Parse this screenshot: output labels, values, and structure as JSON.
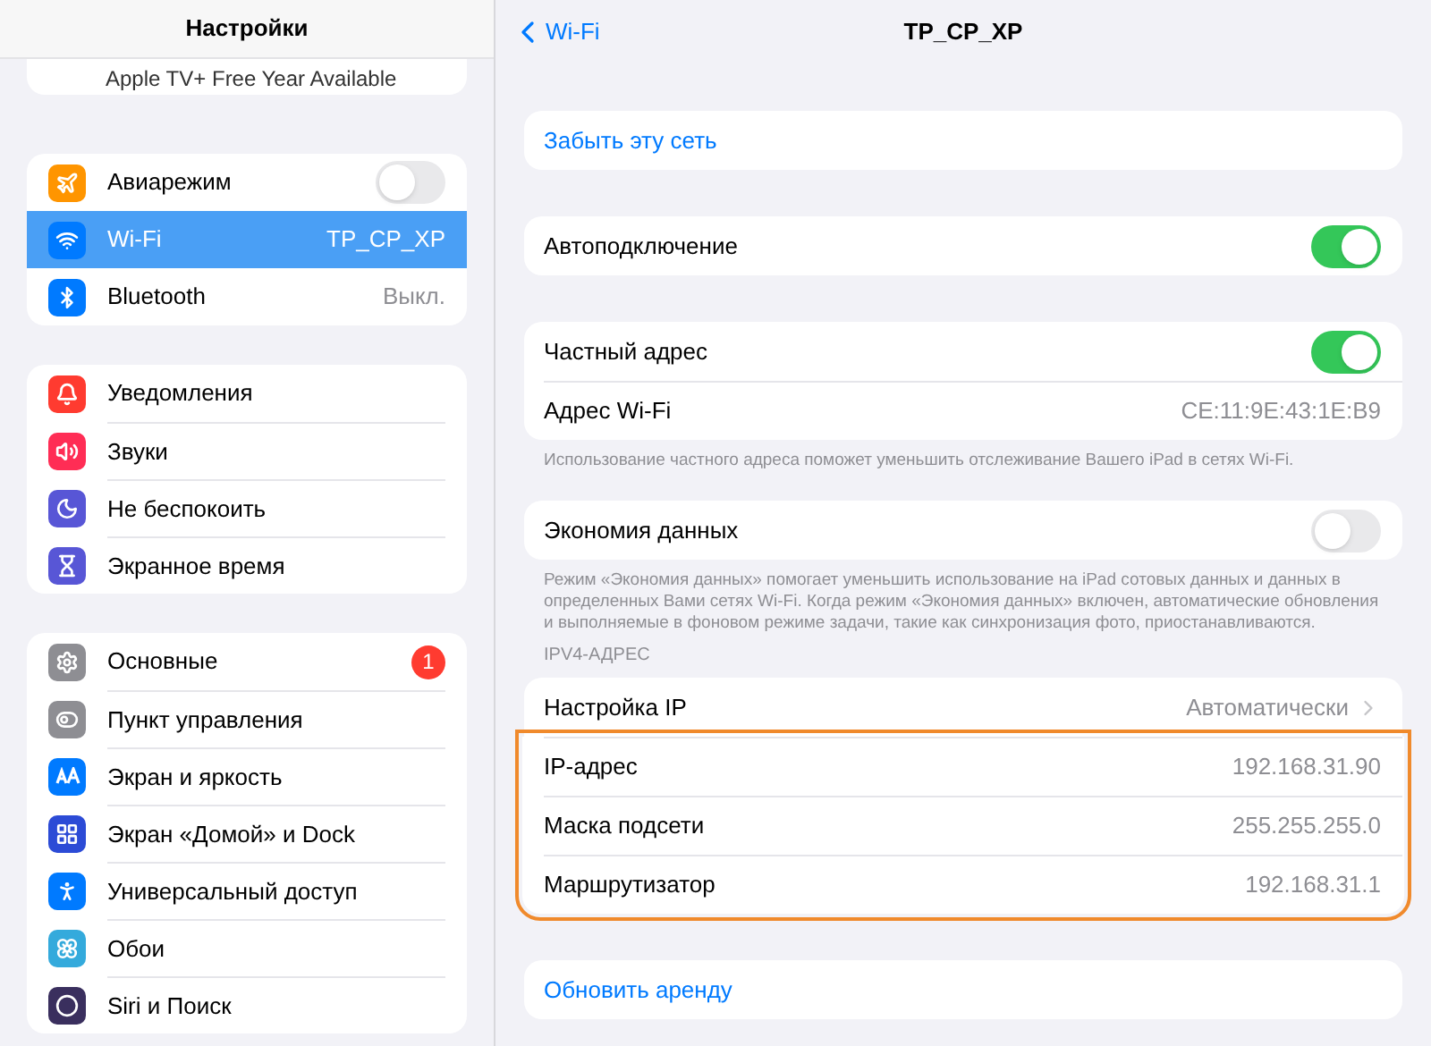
{
  "sidebar": {
    "title": "Настройки",
    "partial_item": "Apple TV+ Free Year Available",
    "groups": [
      [
        {
          "label": "Авиарежим",
          "kind": "toggle",
          "on": false,
          "selected": false
        },
        {
          "label": "Wi-Fi",
          "kind": "value",
          "value": "TP_CP_XP",
          "selected": true
        },
        {
          "label": "Bluetooth",
          "kind": "value",
          "value": "Выкл.",
          "selected": false
        }
      ],
      [
        {
          "label": "Уведомления",
          "kind": "plain",
          "selected": false
        },
        {
          "label": "Звуки",
          "kind": "plain",
          "selected": false
        },
        {
          "label": "Не беспокоить",
          "kind": "plain",
          "selected": false
        },
        {
          "label": "Экранное время",
          "kind": "plain",
          "selected": false
        }
      ],
      [
        {
          "label": "Основные",
          "kind": "badge",
          "value": "1",
          "selected": false
        },
        {
          "label": "Пункт управления",
          "kind": "plain",
          "selected": false
        },
        {
          "label": "Экран и яркость",
          "kind": "plain",
          "selected": false
        },
        {
          "label": "Экран «Домой» и Dock",
          "kind": "plain",
          "selected": false
        },
        {
          "label": "Универсальный доступ",
          "kind": "plain",
          "selected": false
        },
        {
          "label": "Обои",
          "kind": "plain",
          "selected": false
        },
        {
          "label": "Siri и Поиск",
          "kind": "plain",
          "selected": false
        }
      ]
    ]
  },
  "detail": {
    "back": "Wi-Fi",
    "title": "TP_CP_XP",
    "sections": [
      {
        "rows": [
          {
            "kind": "link",
            "label": "Забыть эту сеть"
          }
        ]
      },
      {
        "rows": [
          {
            "kind": "toggle",
            "label": "Автоподключение",
            "on": true
          }
        ]
      },
      {
        "rows": [
          {
            "kind": "toggle",
            "label": "Частный адрес",
            "on": true
          },
          {
            "kind": "value",
            "label": "Адрес Wi-Fi",
            "value": "CE:11:9E:43:1E:B9"
          }
        ],
        "footer": "Использование частного адреса поможет уменьшить отслеживание Вашего iPad в сетях Wi-Fi."
      },
      {
        "rows": [
          {
            "kind": "toggle",
            "label": "Экономия данных",
            "on": false
          }
        ],
        "footer": "Режим «Экономия данных» помогает уменьшить использование на iPad сотовых данных и данных в определенных Вами сетях Wi-Fi. Когда режим «Экономия данных» включен, автоматические обновления и выполняемые в фоновом режиме задачи, такие как синхронизация фото, приостанавливаются."
      },
      {
        "header": "IPV4-АДРЕС",
        "rows": [
          {
            "kind": "disclosure",
            "label": "Настройка IP",
            "value": "Автоматически"
          }
        ],
        "highlighted_rows": [
          {
            "kind": "value",
            "label": "IP-адрес",
            "value": "192.168.31.90"
          },
          {
            "kind": "value",
            "label": "Маска подсети",
            "value": "255.255.255.0"
          },
          {
            "kind": "value",
            "label": "Маршрутизатор",
            "value": "192.168.31.1"
          }
        ]
      },
      {
        "rows": [
          {
            "kind": "link",
            "label": "Обновить аренду"
          }
        ]
      }
    ]
  }
}
